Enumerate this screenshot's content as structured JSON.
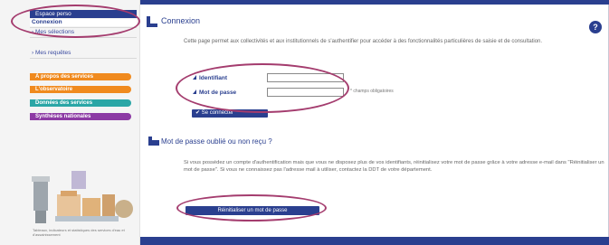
{
  "sidebar": {
    "header": "Espace perso",
    "links": [
      {
        "label": "Connexion"
      },
      {
        "label": "› Mes sélections"
      },
      {
        "label": "› Mes requêtes"
      }
    ],
    "blocks": [
      {
        "label": "À propos des services"
      },
      {
        "label": "L'observatoire"
      },
      {
        "label": "Données des services"
      },
      {
        "label": "Synthèses nationales"
      }
    ],
    "footer": "Tableaux, indicateurs et statistiques des services d'eau et d'assainissement"
  },
  "login": {
    "title": "Connexion",
    "description": "Cette page permet aux collectivités et aux institutionnels de s'authentifier pour accéder à des fonctionnalités particulières de saisie et de consultation.",
    "identifiant_label": "Identifiant",
    "password_label": "Mot de passe",
    "required_note": "* champs obligatoires",
    "submit_label": "✔ Se connecter"
  },
  "forgot": {
    "title": "Mot de passe oublié ou non reçu ?",
    "text": "Si vous possédez un compte d'authentification mais que vous ne disposez plus de vos identifiants, réinitialisez votre mot de passe grâce à votre adresse e-mail dans \"Réinitialiser un mot de passe\". Si vous ne connaissez pas l'adresse mail à utiliser, contactez la DDT de votre département.",
    "reset_label": "Réinitialiser un mot de passe"
  },
  "help": {
    "label": "?"
  },
  "colors": {
    "brand": "#2a3f8f",
    "highlight": "#a43c6e"
  }
}
